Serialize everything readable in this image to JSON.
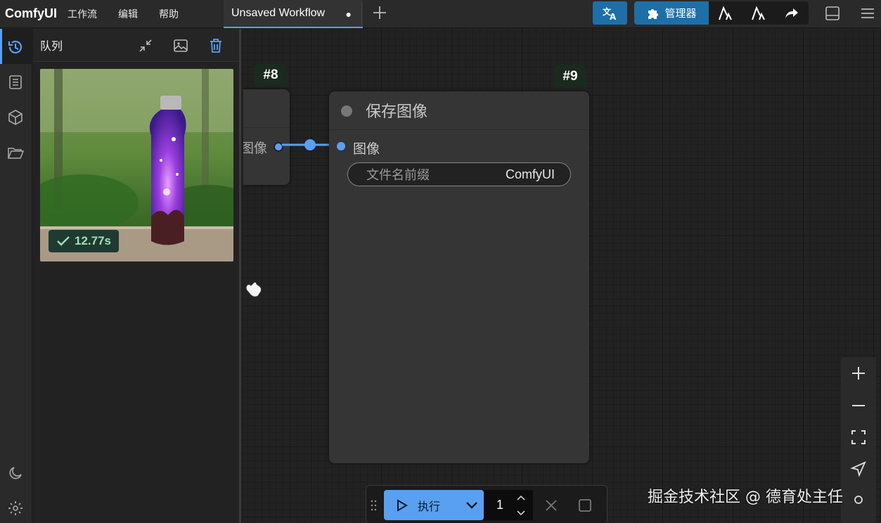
{
  "app": {
    "brand": "ComfyUI"
  },
  "menu": {
    "items": [
      "工作流",
      "编辑",
      "帮助"
    ]
  },
  "tabs": [
    {
      "label": "Unsaved Workflow",
      "modified_marker": "●"
    }
  ],
  "toolbar": {
    "translate_icon": "translate-icon",
    "manager_label": "管理器",
    "icons": [
      "puzzle-icon",
      "model-download-icon",
      "model-download-alt-icon",
      "share-icon",
      "bottom-panel-icon",
      "hamburger-menu-icon"
    ]
  },
  "sidebar": {
    "items": [
      {
        "name": "queue-history",
        "active": true
      },
      {
        "name": "node-library",
        "active": false
      },
      {
        "name": "model-library",
        "active": false
      },
      {
        "name": "workflows",
        "active": false
      }
    ],
    "bottom": [
      "theme-toggle",
      "settings"
    ]
  },
  "queue_panel": {
    "title": "队列",
    "actions": [
      "collapse-icon",
      "image-icon",
      "trash-icon"
    ],
    "items": [
      {
        "duration": "12.77s",
        "status": "success"
      }
    ]
  },
  "nodes": [
    {
      "id": "#8",
      "output_label": "图像"
    },
    {
      "id": "#9",
      "title": "保存图像",
      "input_label": "图像",
      "widget": {
        "name": "文件名前缀",
        "value": "ComfyUI"
      }
    }
  ],
  "run_bar": {
    "run_label": "执行",
    "batch_count": "1"
  },
  "watermark": "掘金技术社区 @ 德育处主任",
  "colors": {
    "accent": "#5aa0f0",
    "manager_bg": "#1e6fa8",
    "success_text": "#9de0b8"
  }
}
